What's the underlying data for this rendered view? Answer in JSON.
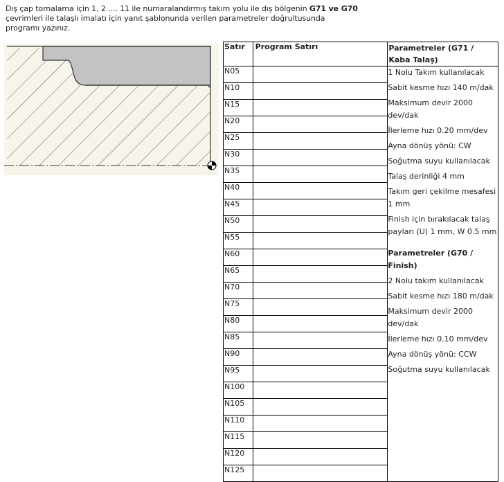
{
  "intro": {
    "line1_pre": "Dış çap tornalama için 1, 2 .... 11 ile numaralandırmış takım yolu ile dış bölgenin ",
    "line1_bold": "G71 ve G70",
    "line2": "çevrimleri ile talaşlı imalatı için yanıt şablonunda verilen parametreler doğrultusunda",
    "line3": "programı yazınız."
  },
  "table": {
    "col_satir": "Satır",
    "col_program": "Program Satırı",
    "col_params": "Parametreler (G71 / Kaba Talaş)",
    "rows": [
      "N05",
      "N10",
      "N15",
      "N20",
      "N25",
      "N30",
      "N35",
      "N40",
      "N45",
      "N50",
      "N55",
      "N60",
      "N65",
      "N70",
      "N75",
      "N80",
      "N85",
      "N90",
      "N95",
      "N100",
      "N105",
      "N110",
      "N115",
      "N120",
      "N125"
    ]
  },
  "params_g71": [
    "1 Nolu Takım kullanılacak",
    "Sabit kesme hızı 140 m/dak",
    "Maksimum devir 2000 dev/dak",
    "İlerleme hızı 0.20 mm/dev",
    "Ayna dönüş yönü: CW",
    "Soğutma suyu kullanılacak",
    "Talaş derinliği 4 mm",
    "Takım geri çekilme mesafesi 1 mm",
    "Finish için bırakılacak talaş payları (U) 1 mm, W 0.5 mm"
  ],
  "params_g70_title": "Parametreler (G70 / Finish)",
  "params_g70": [
    "2 Nolu takım kullanılacak",
    "Sabit kesme hızı 180 m/dak",
    "Maksimum devir 2000 dev/dak",
    "İlerleme hızı 0.10 mm/dev",
    "Ayna dönüş yönü: CCW",
    "Soğutma suyu kullanılacak"
  ]
}
